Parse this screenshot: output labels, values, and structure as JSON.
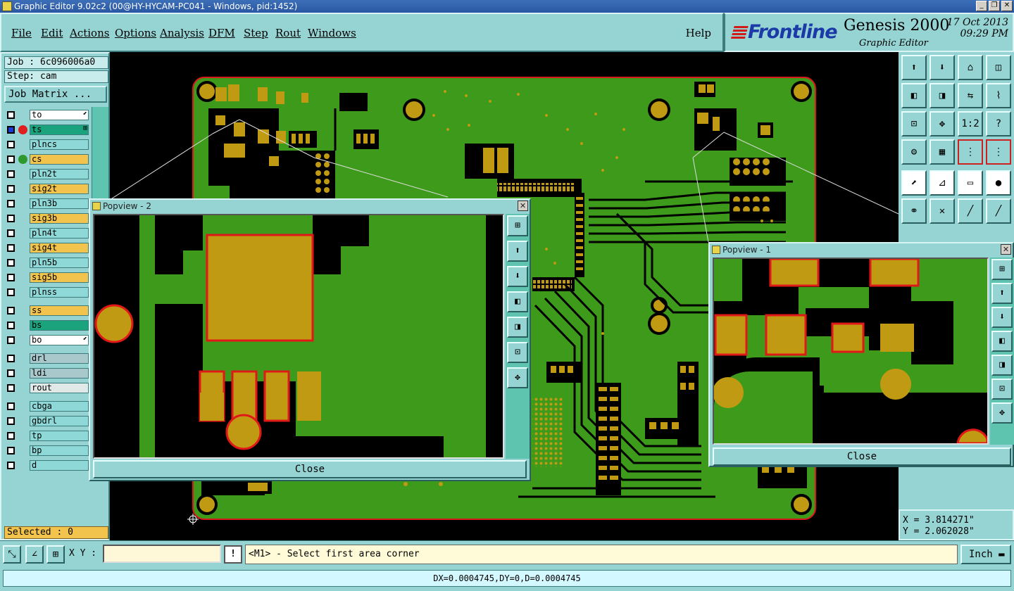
{
  "window": {
    "title": "Graphic Editor 9.02c2 (00@HY-HYCAM-PC041 - Windows, pid:1452)",
    "minimize": "_",
    "restore": "❐",
    "close": "✕"
  },
  "menu": {
    "items": [
      "File",
      "Edit",
      "Actions",
      "Options",
      "Analysis",
      "DFM",
      "Step",
      "Rout",
      "Windows"
    ],
    "help": "Help"
  },
  "brand": {
    "logo": "Frontline",
    "product": "Genesis 2000",
    "subtitle": "Graphic Editor",
    "date": "17 Oct 2013",
    "time": "09:29 PM"
  },
  "left": {
    "job": "Job : 6c096006a0",
    "step": "Step: cam",
    "job_matrix": "Job Matrix ...",
    "selected": "Selected : 0"
  },
  "layers": [
    {
      "name": "to",
      "bg": "#ffffff",
      "indicator": "",
      "arrow": "⬋"
    },
    {
      "name": "ts",
      "bg": "#1aa37c",
      "indicator": "#e02020",
      "arrow": "⊞",
      "box_filled": true
    },
    {
      "name": "plncs",
      "bg": "#8ed8d8",
      "indicator": ""
    },
    {
      "name": "cs",
      "bg": "#f2c44e",
      "indicator": "#2e9a2e"
    },
    {
      "name": "pln2t",
      "bg": "#8ed8d8",
      "indicator": ""
    },
    {
      "name": "sig2t",
      "bg": "#f2c44e",
      "indicator": ""
    },
    {
      "name": "pln3b",
      "bg": "#8ed8d8",
      "indicator": ""
    },
    {
      "name": "sig3b",
      "bg": "#f2c44e",
      "indicator": ""
    },
    {
      "name": "pln4t",
      "bg": "#8ed8d8",
      "indicator": ""
    },
    {
      "name": "sig4t",
      "bg": "#f2c44e",
      "indicator": ""
    },
    {
      "name": "pln5b",
      "bg": "#8ed8d8",
      "indicator": ""
    },
    {
      "name": "sig5b",
      "bg": "#f2c44e",
      "indicator": ""
    },
    {
      "name": "plnss",
      "bg": "#8ed8d8",
      "indicator": ""
    },
    {
      "name": "ss",
      "bg": "#f2c44e",
      "indicator": ""
    },
    {
      "name": "bs",
      "bg": "#1aa37c",
      "indicator": ""
    },
    {
      "name": "bo",
      "bg": "#ffffff",
      "indicator": "",
      "arrow": "⬋"
    },
    {
      "name": "drl",
      "bg": "#a8c8cc",
      "indicator": ""
    },
    {
      "name": "ldi",
      "bg": "#a8c8cc",
      "indicator": ""
    },
    {
      "name": "rout",
      "bg": "#e0e8e8",
      "indicator": ""
    },
    {
      "name": "cbga",
      "bg": "#8ed8d8",
      "indicator": ""
    },
    {
      "name": "gbdrl",
      "bg": "#8ed8d8",
      "indicator": ""
    },
    {
      "name": "tp",
      "bg": "#8ed8d8",
      "indicator": ""
    },
    {
      "name": "bp",
      "bg": "#8ed8d8",
      "indicator": ""
    },
    {
      "name": "d",
      "bg": "#8ed8d8",
      "indicator": ""
    }
  ],
  "toolbar": {
    "buttons": [
      {
        "name": "zoom-up-icon",
        "glyph": "⬆"
      },
      {
        "name": "zoom-down-icon",
        "glyph": "⬇"
      },
      {
        "name": "home-icon",
        "glyph": "⌂"
      },
      {
        "name": "split-icon",
        "glyph": "◫"
      },
      {
        "name": "pan-left-icon",
        "glyph": "◧"
      },
      {
        "name": "pan-right-icon",
        "glyph": "◨"
      },
      {
        "name": "swap-icon",
        "glyph": "⇆"
      },
      {
        "name": "step-icon",
        "glyph": "⌇"
      },
      {
        "name": "zoom-fit-icon",
        "glyph": "⊡"
      },
      {
        "name": "zoom-center-icon",
        "glyph": "✥"
      },
      {
        "name": "scale-icon",
        "glyph": "1:2"
      },
      {
        "name": "help-icon",
        "glyph": "?"
      },
      {
        "name": "tools-icon",
        "glyph": "⚙"
      },
      {
        "name": "grid-icon",
        "glyph": "▦"
      },
      {
        "name": "net-icon",
        "glyph": "⋮",
        "red": true
      },
      {
        "name": "net2-icon",
        "glyph": "⋮",
        "red": true
      },
      {
        "name": "select-icon",
        "glyph": "⬈",
        "white": true
      },
      {
        "name": "measure-icon",
        "glyph": "⊿",
        "white": true
      },
      {
        "name": "ruler-icon",
        "glyph": "▭",
        "white": true
      },
      {
        "name": "pad-icon",
        "glyph": "●",
        "white": true
      },
      {
        "name": "connect-icon",
        "glyph": "⚭"
      },
      {
        "name": "snap-icon",
        "glyph": "✕"
      },
      {
        "name": "line-icon",
        "glyph": "╱"
      },
      {
        "name": "arc-icon",
        "glyph": "╱"
      }
    ]
  },
  "coords": {
    "x": "X = 3.814271\"",
    "y": "Y = 2.062028\""
  },
  "bottom": {
    "xy_label": "X Y :",
    "xy_value": "",
    "warn": "!",
    "prompt": "<M1> - Select first area corner",
    "unit": "Inch",
    "status": "DX=0.0004745,DY=0,D=0.0004745"
  },
  "popview2": {
    "title": "Popview - 2",
    "close": "Close",
    "close_x": "✕"
  },
  "popview1": {
    "title": "Popview - 1",
    "close": "Close",
    "close_x": "✕"
  },
  "popview_tools": [
    "⊞",
    "⬆",
    "⬇",
    "◧",
    "◨",
    "⊡",
    "✥"
  ],
  "colors": {
    "board": "#3d9a1a",
    "copper": "#c19a13",
    "outline": "#d81a1a",
    "panel": "#96d4d4"
  }
}
